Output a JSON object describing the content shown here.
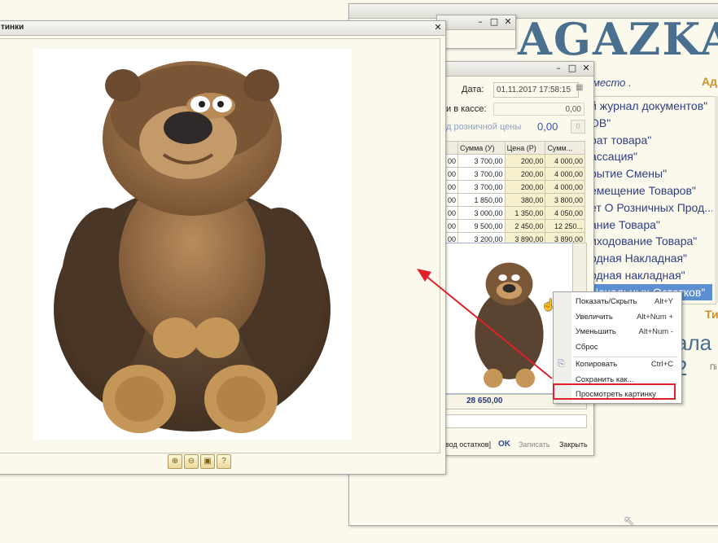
{
  "bg_window": {
    "banner": "AGAZKA",
    "place_label": "место .",
    "right_top_label": "Ад",
    "list": [
      "й журнал документов\"",
      "ОВ\"",
      "рат товара\"",
      "ассация\"",
      "рытие Смены\"",
      "емещение Товаров\"",
      "ет О Розничных Прод...",
      "ание Товара\"",
      "иходование Товара\"",
      "одная Накладная\"",
      "одная накладная\"",
      "Начальных Остатков\""
    ],
    "bottom_label_1": "Ти",
    "big_text": "ала 2",
    "small_text": "Пі"
  },
  "doc_window": {
    "date_label": "Дата:",
    "date_value": "01.11.2017 17:58:15",
    "cash_label": "и в кассе:",
    "cash_value": "0,00",
    "retail_label": "д розничной цены",
    "retail_value": "0,00",
    "retail_button": "0",
    "columns": [
      "Сумма (У)",
      "Цена (Р)",
      "Сумм..."
    ],
    "rows": [
      [
        "00",
        "3 700,00",
        "200,00",
        "4 000,00"
      ],
      [
        "00",
        "3 700,00",
        "200,00",
        "4 000,00"
      ],
      [
        "00",
        "3 700,00",
        "200,00",
        "4 000,00"
      ],
      [
        "00",
        "1 850,00",
        "380,00",
        "3 800,00"
      ],
      [
        "00",
        "3 000,00",
        "1 350,00",
        "4 050,00"
      ],
      [
        "00",
        "9 500,00",
        "2 450,00",
        "12 250..."
      ],
      [
        "00",
        "3 200,00",
        "3 890,00",
        "3 890,00"
      ]
    ],
    "total": "28 650,00",
    "footer_label": "вод остатков]",
    "ok_label": "OK",
    "save_label": "Записать",
    "close_label": "Закрыть"
  },
  "pic_window": {
    "title": "тинки",
    "tools": [
      "zoom-in-icon",
      "zoom-out-icon",
      "fit-icon",
      "help-icon"
    ]
  },
  "context_menu": {
    "items": [
      {
        "label": "Показать/Скрыть",
        "shortcut": "Alt+Y"
      },
      {
        "label": "Увеличить",
        "shortcut": "Alt+Num +"
      },
      {
        "label": "Уменьшить",
        "shortcut": "Alt+Num -"
      },
      {
        "label": "Сброс",
        "shortcut": ""
      },
      {
        "label": "Копировать",
        "shortcut": "Ctrl+C"
      },
      {
        "label": "Сохранить как...",
        "shortcut": ""
      },
      {
        "label": "Просмотреть картинку",
        "shortcut": ""
      }
    ],
    "highlight_color": "#e0202a"
  },
  "colors": {
    "background": "#fbf9ec",
    "accent_blue": "#4b6f8e",
    "selection": "#5c8fd1",
    "arrow": "#e0202a"
  }
}
